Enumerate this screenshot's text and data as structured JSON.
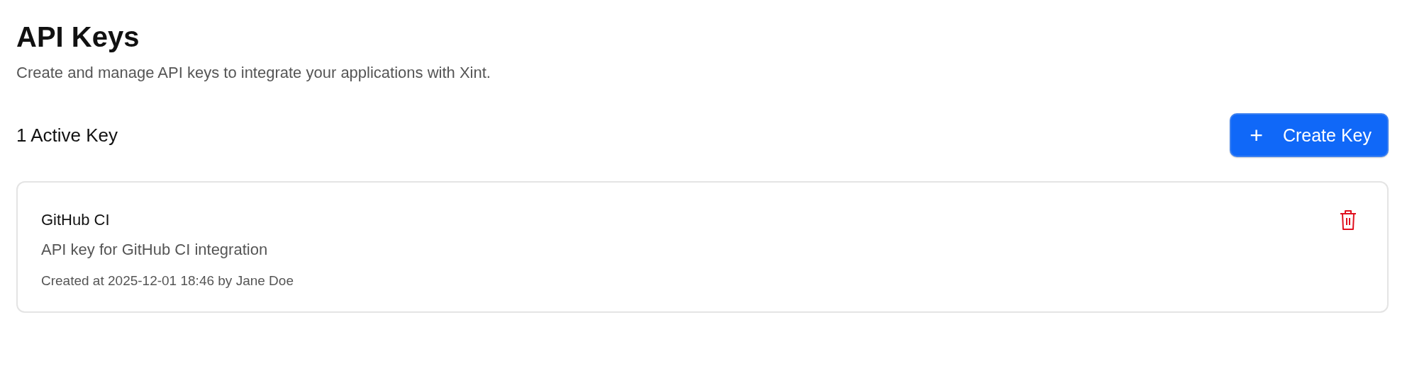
{
  "page": {
    "title": "API Keys",
    "subtitle": "Create and manage API keys to integrate your applications with Xint."
  },
  "section": {
    "heading": "1 Active Key",
    "button": {
      "icon": "+",
      "label": "Create Key"
    }
  },
  "keys": [
    {
      "name": "GitHub CI",
      "description": "API key for GitHub CI integration",
      "meta": "Created at 2025-12-01 18:46 by Jane Doe"
    }
  ]
}
